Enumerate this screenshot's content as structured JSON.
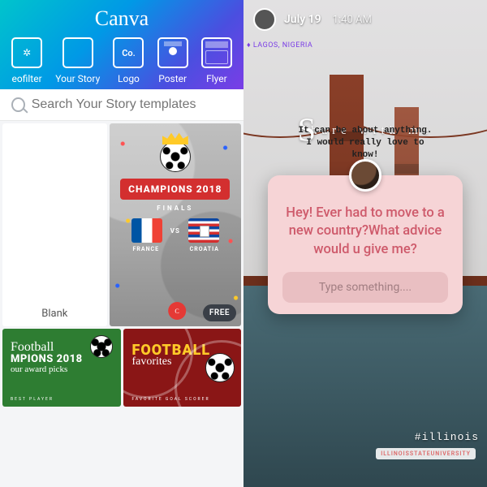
{
  "canva": {
    "logo": "Canva",
    "types": [
      {
        "label": "eofilter"
      },
      {
        "label": "Your Story"
      },
      {
        "label": "Logo",
        "inner": "Co."
      },
      {
        "label": "Poster"
      },
      {
        "label": "Flyer"
      }
    ],
    "search_placeholder": "Search Your Story templates",
    "templates": {
      "blank": "Blank",
      "champions": {
        "title": "CHAMPIONS 2018",
        "subtitle": "FINALS",
        "vs": "VS",
        "team_a": "FRANCE",
        "team_b": "CROATIA",
        "badge": "FREE",
        "brand": "C"
      },
      "green": {
        "line1": "Football",
        "line2": "MPIONS 2018",
        "line3": "our award picks",
        "tiny": "BEST PLAYER"
      },
      "red": {
        "line1": "FOOTBALL",
        "line2": "favorites",
        "tiny": "FAVORITE GOAL SCORER"
      }
    }
  },
  "story": {
    "date": "July 19",
    "time": "1:40 AM",
    "location": "♦ LAGOS, NIGERIA",
    "share_cap": "S",
    "share_rest": "hare with me",
    "share_sub_1": "It can be about anything.",
    "share_sub_2": "I would really love to",
    "share_sub_3": "know!",
    "question": "Hey! Ever had to move to a new country?What advice would u give me?",
    "input_placeholder": "Type something....",
    "hashtag": "#illinois",
    "uni": "ILLINOISSTATEUNIVERSITY"
  }
}
